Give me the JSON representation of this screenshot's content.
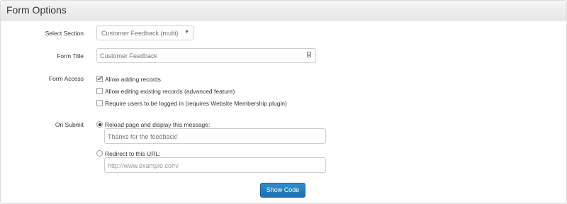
{
  "panel": {
    "title": "Form Options"
  },
  "select_section": {
    "label": "Select Section",
    "value": "Customer Feedback (multi)"
  },
  "form_title": {
    "label": "Form Title",
    "value": "Customer Feedback"
  },
  "form_access": {
    "label": "Form Access",
    "options": [
      {
        "label": "Allow adding records",
        "checked": true
      },
      {
        "label": "Allow editing existing records (advanced feature)",
        "checked": false
      },
      {
        "label": "Require users to be logged in (requires Website Membership plugin)",
        "checked": false
      }
    ]
  },
  "on_submit": {
    "label": "On Submit",
    "reload": {
      "label": "Reload page and display this message:",
      "selected": true,
      "message": "Thanks for the feedback!"
    },
    "redirect": {
      "label": "Redirect to this URL:",
      "selected": false,
      "placeholder": "http://www.example.com/"
    }
  },
  "show_code_button": "Show Code"
}
